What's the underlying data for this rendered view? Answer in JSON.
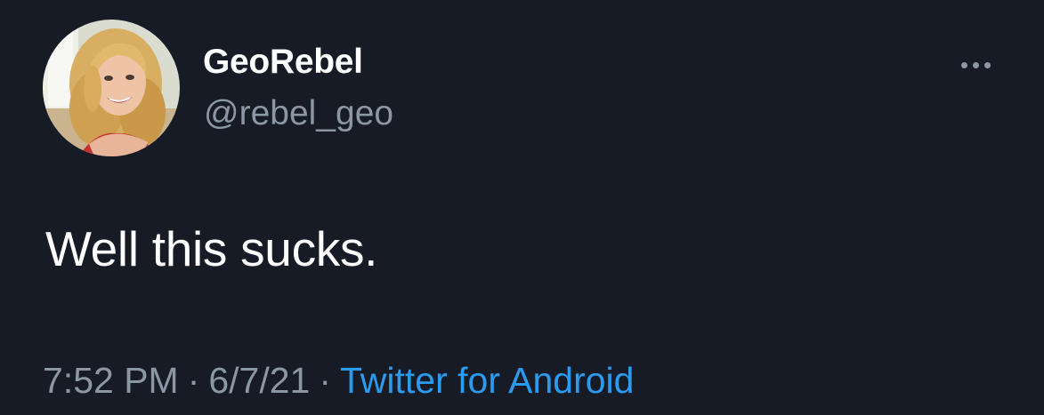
{
  "tweet": {
    "author": {
      "display_name": "GeoRebel",
      "handle": "@rebel_geo",
      "avatar_icon": "profile-photo"
    },
    "more_icon": "more-horizontal-icon",
    "text": "Well this sucks.",
    "meta": {
      "time": "7:52 PM",
      "separator": "·",
      "date": "6/7/21",
      "source": "Twitter for Android"
    }
  },
  "colors": {
    "background": "#161b26",
    "primary_text": "#ffffff",
    "secondary_text": "#8b97a3",
    "link": "#2b9bf0"
  }
}
